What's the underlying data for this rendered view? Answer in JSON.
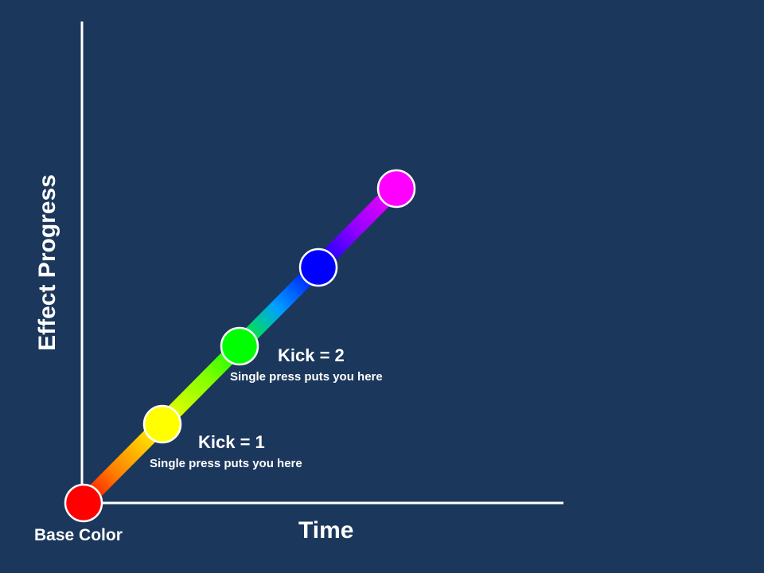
{
  "axes": {
    "y_label": "Effect Progress",
    "x_label": "Time"
  },
  "base_label": "Base Color",
  "kicks": [
    {
      "title": "Kick = 1",
      "subtitle": "Single press puts you here"
    },
    {
      "title": "Kick = 2",
      "subtitle": "Single press puts you here"
    }
  ],
  "steps": [
    {
      "name": "base",
      "color": "#ff0000"
    },
    {
      "name": "kick-1",
      "color": "#ffff00"
    },
    {
      "name": "kick-2",
      "color": "#00ff00"
    },
    {
      "name": "kick-3",
      "color": "#0000ff"
    },
    {
      "name": "kick-4",
      "color": "#ff00ff"
    }
  ],
  "colors": {
    "background": "#1b375c",
    "axis": "#ffffff",
    "gradient": [
      "#ff0000",
      "#ff8000",
      "#ffff00",
      "#80ff00",
      "#00ff00",
      "#0090ff",
      "#0000ff",
      "#9000ff",
      "#ff00ff"
    ]
  }
}
